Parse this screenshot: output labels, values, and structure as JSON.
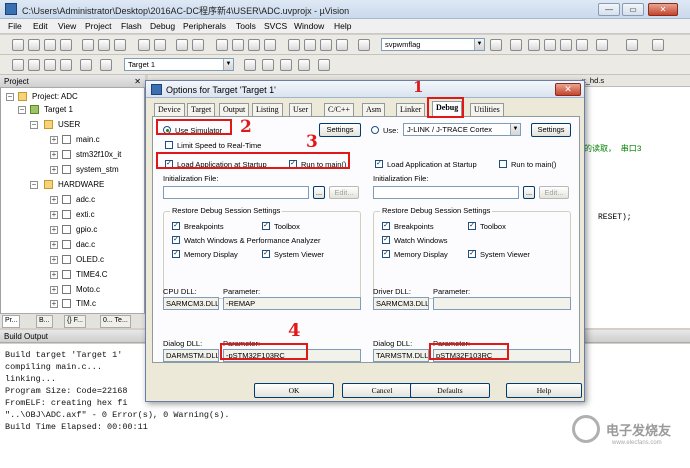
{
  "window": {
    "title": "C:\\Users\\Administrator\\Desktop\\2016AC-DC程序新4\\USER\\ADC.uvprojx - µVision",
    "min": "—",
    "max": "▭",
    "close": "✕"
  },
  "menu": [
    "File",
    "Edit",
    "View",
    "Project",
    "Flash",
    "Debug",
    "Peripherals",
    "Tools",
    "SVCS",
    "Window",
    "Help"
  ],
  "toolbar": {
    "find_value": "svpwmflag",
    "target_value": "Target 1"
  },
  "project_panel": {
    "title": "Project",
    "close": "✕",
    "root": "Project: ADC",
    "target": "Target 1",
    "groups": [
      {
        "name": "USER",
        "files": [
          "main.c",
          "stm32f10x_it",
          "system_stm"
        ]
      },
      {
        "name": "HARDWARE",
        "files": [
          "adc.c",
          "exti.c",
          "gpio.c",
          "dac.c",
          "OLED.c",
          "TIME4.C",
          "Moto.c",
          "TIM.c"
        ]
      }
    ],
    "tabs": [
      "Pr...",
      "B...",
      "{} F...",
      "0... Te..."
    ]
  },
  "editor": {
    "tab_fragment": "x_hd.s",
    "code_fragment_1": "的读取，  串口3",
    "code_fragment_2": "RESET);"
  },
  "build_output": {
    "title": "Build Output",
    "lines": [
      "Build target 'Target 1'",
      "compiling main.c...",
      "linking...",
      "Program Size: Code=22168",
      "FromELF: creating hex fi",
      "\"..\\OBJ\\ADC.axf\" - 0 Error(s), 0 Warning(s).",
      "Build Time Elapsed:  00:00:11"
    ]
  },
  "dialog": {
    "title": "Options for Target 'Target 1'",
    "close": "✕",
    "tabs": [
      "Device",
      "Target",
      "Output",
      "Listing",
      "User",
      "C/C++",
      "Asm",
      "Linker",
      "Debug",
      "Utilities"
    ],
    "active_tab": "Debug",
    "left": {
      "use_simulator": "Use Simulator",
      "limit_speed": "Limit Speed to Real-Time",
      "settings": "Settings",
      "load_app": "Load Application at Startup",
      "run_to_main": "Run to main()",
      "init_file": "Initialization File:",
      "browse": "...",
      "edit": "Edit...",
      "restore_title": "Restore Debug Session Settings",
      "breakpoints": "Breakpoints",
      "toolbox": "Toolbox",
      "watch": "Watch Windows & Performance Analyzer",
      "memory": "Memory Display",
      "sysview": "System Viewer",
      "cpu_dll_label": "CPU DLL:",
      "param_label": "Parameter:",
      "cpu_dll": "SARMCM3.DLL",
      "cpu_param": "-REMAP",
      "dialog_dll_label": "Dialog DLL:",
      "dialog_dll": "DARMSTM.DLL",
      "dialog_param": "-pSTM32F103RC"
    },
    "right": {
      "use": "Use:",
      "driver": "J-LINK / J-TRACE Cortex",
      "settings": "Settings",
      "load_app": "Load Application at Startup",
      "run_to_main": "Run to main()",
      "init_file": "Initialization File:",
      "browse": "...",
      "edit": "Edit...",
      "restore_title": "Restore Debug Session Settings",
      "breakpoints": "Breakpoints",
      "toolbox": "Toolbox",
      "watch": "Watch Windows",
      "memory": "Memory Display",
      "sysview": "System Viewer",
      "driver_dll_label": "Driver DLL:",
      "param_label": "Parameter:",
      "driver_dll": "SARMCM3.DLL",
      "driver_param": "",
      "dialog_dll_label": "Dialog DLL:",
      "dialog_dll": "TARMSTM.DLL",
      "dialog_param": "pSTM32F103RC"
    },
    "buttons": {
      "ok": "OK",
      "cancel": "Cancel",
      "defaults": "Defaults",
      "help": "Help"
    }
  },
  "annotations": {
    "a1": "1",
    "a2": "2",
    "a3": "3",
    "a4": "4"
  },
  "watermark": {
    "text": "电子发烧友",
    "sub": "www.elecfans.com"
  },
  "colors": {
    "highlight": "#e01818",
    "titlebar": "#dfe9f5",
    "dialog_bg": "#ece9d8"
  }
}
